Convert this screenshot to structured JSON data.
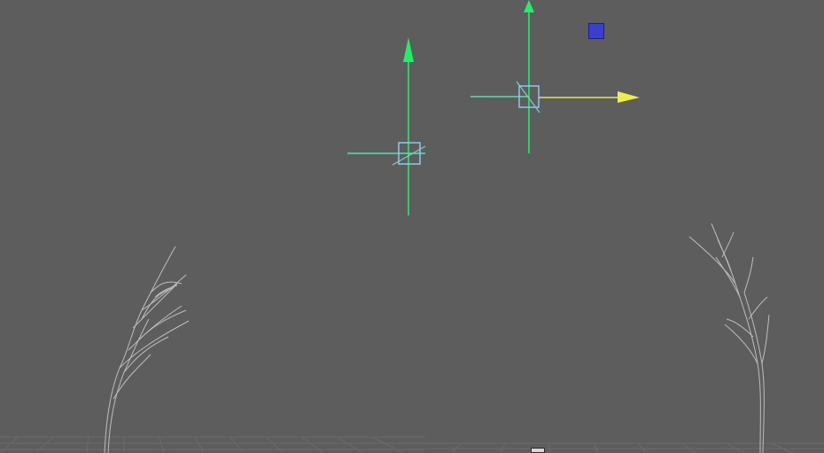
{
  "viewport": {
    "background": "#5c5c5c",
    "grid_color": "#6a6a6a",
    "panels": [
      "left-view",
      "right-view"
    ]
  },
  "manipulators": {
    "left": {
      "y_axis_color": "#00ff55",
      "x_axis_color": "#7fffd4",
      "center_color": "#8fd0ff"
    },
    "right": {
      "y_axis_color": "#00ff55",
      "x_axis_color": "#ffff66",
      "center_color": "#8fd0ff"
    }
  },
  "handles": {
    "blue_square_color": "#3a3fd0",
    "bottom_toggle_icon": "toggle-icon"
  },
  "objects": [
    "tree-left",
    "tree-right"
  ]
}
